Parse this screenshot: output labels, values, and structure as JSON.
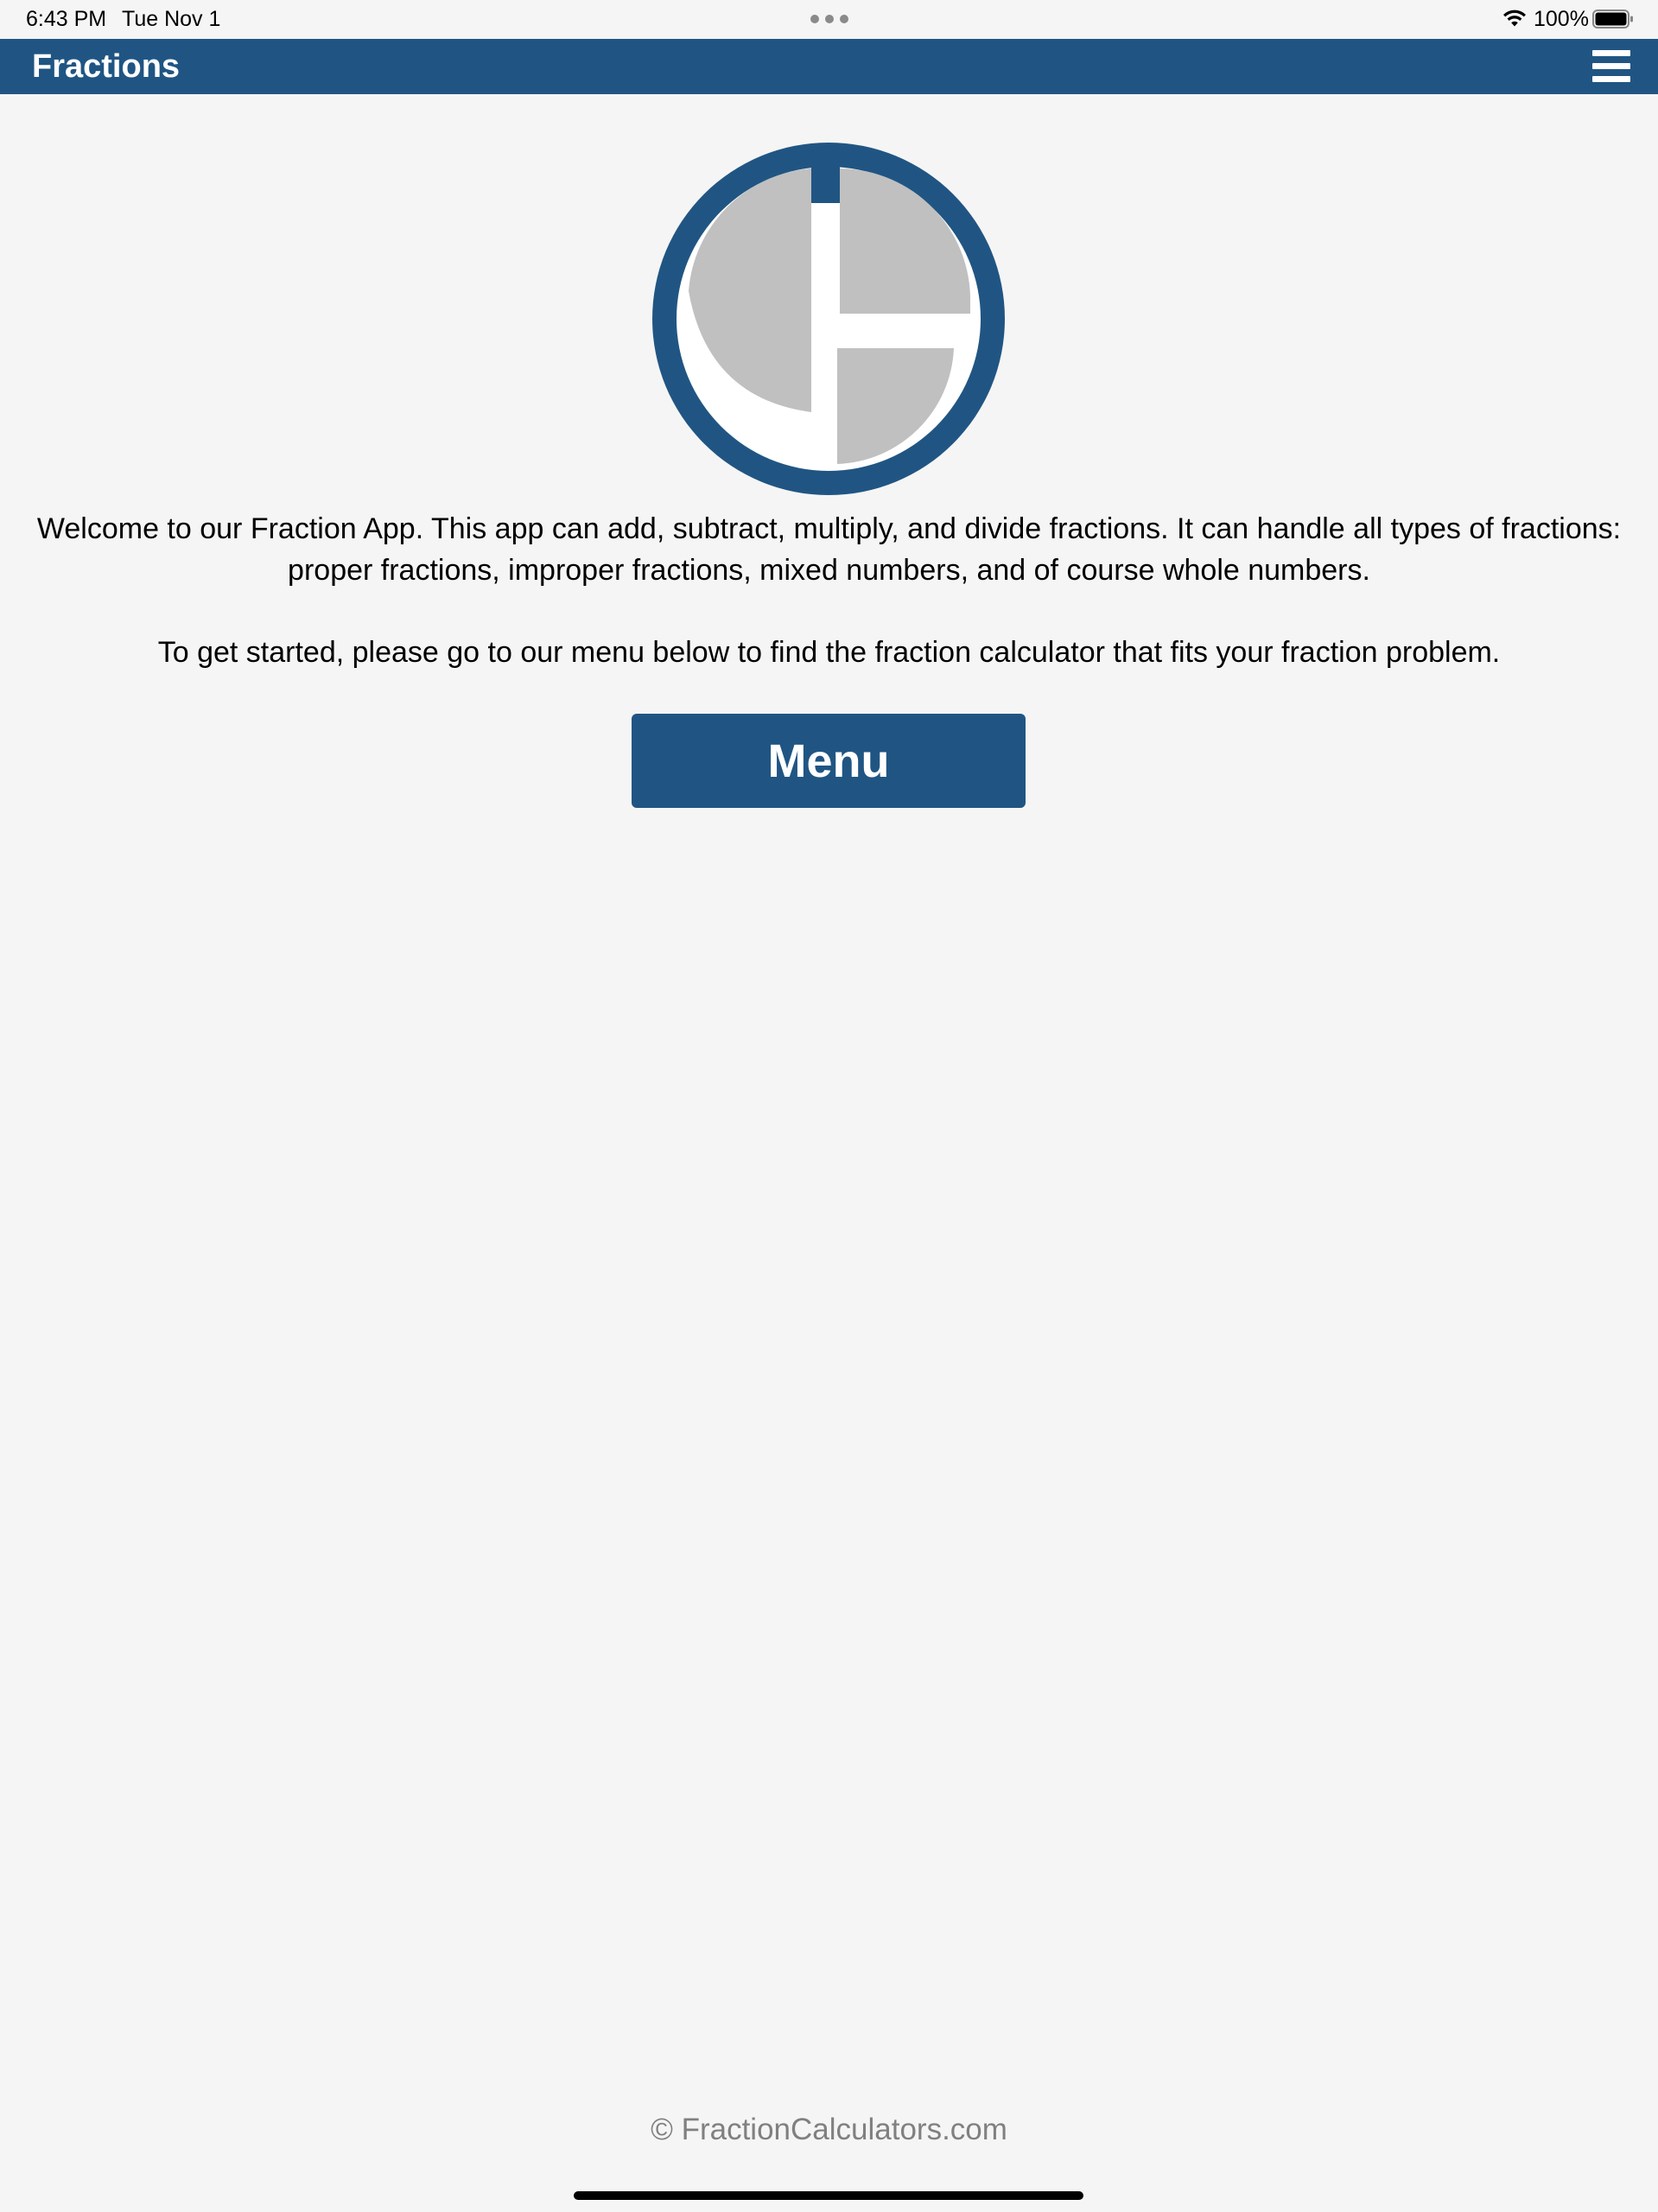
{
  "status_bar": {
    "time": "6:43 PM",
    "date": "Tue Nov 1",
    "battery_percent": "100%",
    "icons": [
      "multitasking-dots-icon",
      "wifi-icon",
      "battery-icon"
    ]
  },
  "navbar": {
    "title": "Fractions",
    "menu_icon": "hamburger-menu-icon",
    "background_color": "#205583"
  },
  "logo": {
    "icon": "fraction-pie-logo",
    "colors": {
      "ring": "#205583",
      "slices": "#c0c0c0",
      "background": "#ffffff"
    }
  },
  "main": {
    "intro_text": "Welcome to our Fraction App. This app can add, subtract, multiply, and divide fractions. It can handle all types of fractions: proper fractions, improper fractions, mixed numbers, and of course whole numbers.",
    "instructions_text": "To get started, please go to our menu below to find the fraction calculator that fits your fraction problem.",
    "menu_button_label": "Menu"
  },
  "footer": {
    "copyright": "© FractionCalculators.com"
  }
}
